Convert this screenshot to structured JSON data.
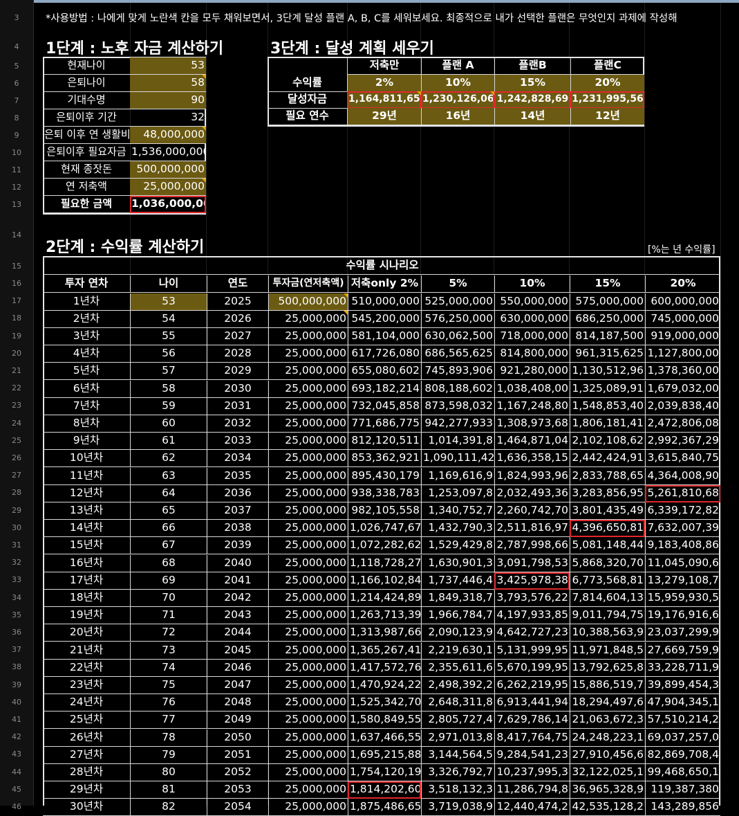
{
  "note": "*사용방법 : 나에게 맞게 노란색 칸을 모두 채워보면서, 3단계 달성 플랜 A, B, C를 세워보세요. 최종적으로 내가 선택한 플랜은 무엇인지 과제에 작성해",
  "row_numbers": [
    "3",
    "4",
    "5",
    "6",
    "7",
    "8",
    "9",
    "10",
    "11",
    "12",
    "13",
    "14",
    "15",
    "16",
    "17",
    "18",
    "19",
    "20",
    "21",
    "22",
    "23",
    "24",
    "25",
    "26",
    "27",
    "28",
    "29",
    "30",
    "31",
    "32",
    "33",
    "34",
    "35",
    "36",
    "37",
    "38",
    "39",
    "40",
    "41",
    "42",
    "43",
    "44",
    "45",
    "46"
  ],
  "step1": {
    "title": "1단계 : 노후 자금 계산하기",
    "rows": [
      {
        "label": "현재나이",
        "value": "53"
      },
      {
        "label": "은퇴나이",
        "value": "58"
      },
      {
        "label": "기대수명",
        "value": "90"
      },
      {
        "label": "은퇴이후 기간",
        "value": "32"
      },
      {
        "label": "은퇴 이후 연 생활비",
        "value": "48,000,000"
      },
      {
        "label": "은퇴이후 필요자금",
        "value": "1,536,000,000"
      },
      {
        "label": "현재 종잣돈",
        "value": "500,000,000"
      },
      {
        "label": "연 저축액",
        "value": "25,000,000"
      },
      {
        "label": "필요한 금액",
        "value": "1,036,000,000"
      }
    ]
  },
  "step3": {
    "title": "3단계 : 달성 계획 세우기",
    "headers": [
      "저축만",
      "플랜 A",
      "플랜B",
      "플랜C"
    ],
    "row_labels": [
      "수익률",
      "달성자금",
      "필요 연수"
    ],
    "returns": [
      "2%",
      "10%",
      "15%",
      "20%"
    ],
    "funds": [
      "1,164,811,650",
      "1,230,126,06",
      "1,242,828,69",
      "1,231,995,56"
    ],
    "years": [
      "29년",
      "16년",
      "14년",
      "12년"
    ]
  },
  "step2": {
    "title": "2단계 : 수익률 계산하기",
    "unit_note": "[%는 년 수익률]",
    "scenario_header": "수익률 시나리오",
    "headers": [
      "투자 연차",
      "나이",
      "연도",
      "투자금(연저축액)",
      "저축only 2%",
      "5%",
      "10%",
      "15%",
      "20%"
    ],
    "rows": [
      [
        "1년차",
        "53",
        "2025",
        "500,000,000",
        "510,000,000",
        "525,000,000",
        "550,000,000",
        "575,000,000",
        "600,000,000"
      ],
      [
        "2년차",
        "54",
        "2026",
        "25,000,000",
        "545,200,000",
        "576,250,000",
        "630,000,000",
        "686,250,000",
        "745,000,000"
      ],
      [
        "3년차",
        "55",
        "2027",
        "25,000,000",
        "581,104,000",
        "630,062,500",
        "718,000,000",
        "814,187,500",
        "919,000,000"
      ],
      [
        "4년차",
        "56",
        "2028",
        "25,000,000",
        "617,726,080",
        "686,565,625",
        "814,800,000",
        "961,315,625",
        "1,127,800,00"
      ],
      [
        "5년차",
        "57",
        "2029",
        "25,000,000",
        "655,080,602",
        "745,893,906",
        "921,280,000",
        "1,130,512,96",
        "1,378,360,00"
      ],
      [
        "6년차",
        "58",
        "2030",
        "25,000,000",
        "693,182,214",
        "808,188,602",
        "1,038,408,00",
        "1,325,089,91",
        "1,679,032,00"
      ],
      [
        "7년차",
        "59",
        "2031",
        "25,000,000",
        "732,045,858",
        "873,598,032",
        "1,167,248,80",
        "1,548,853,40",
        "2,039,838,40"
      ],
      [
        "8년차",
        "60",
        "2032",
        "25,000,000",
        "771,686,775",
        "942,277,933",
        "1,308,973,68",
        "1,806,181,41",
        "2,472,806,08"
      ],
      [
        "9년차",
        "61",
        "2033",
        "25,000,000",
        "812,120,511",
        "1,014,391,8",
        "1,464,871,04",
        "2,102,108,62",
        "2,992,367,29"
      ],
      [
        "10년차",
        "62",
        "2034",
        "25,000,000",
        "853,362,921",
        "1,090,111,42",
        "1,636,358,15",
        "2,442,424,91",
        "3,615,840,75"
      ],
      [
        "11년차",
        "63",
        "2035",
        "25,000,000",
        "895,430,179",
        "1,169,616,9",
        "1,824,993,96",
        "2,833,788,65",
        "4,364,008,90"
      ],
      [
        "12년차",
        "64",
        "2036",
        "25,000,000",
        "938,338,783",
        "1,253,097,8",
        "2,032,493,36",
        "3,283,856,95",
        "5,261,810,68"
      ],
      [
        "13년차",
        "65",
        "2037",
        "25,000,000",
        "982,105,558",
        "1,340,752,7",
        "2,260,742,70",
        "3,801,435,49",
        "6,339,172,82"
      ],
      [
        "14년차",
        "66",
        "2038",
        "25,000,000",
        "1,026,747,67",
        "1,432,790,3",
        "2,511,816,97",
        "4,396,650,81",
        "7,632,007,39"
      ],
      [
        "15년차",
        "67",
        "2039",
        "25,000,000",
        "1,072,282,62",
        "1,529,429,8",
        "2,787,998,66",
        "5,081,148,44",
        "9,183,408,86"
      ],
      [
        "16년차",
        "68",
        "2040",
        "25,000,000",
        "1,118,728,27",
        "1,630,901,3",
        "3,091,798,53",
        "5,868,320,70",
        "11,045,090,6"
      ],
      [
        "17년차",
        "69",
        "2041",
        "25,000,000",
        "1,166,102,84",
        "1,737,446,4",
        "3,425,978,38",
        "6,773,568,81",
        "13,279,108,7"
      ],
      [
        "18년차",
        "70",
        "2042",
        "25,000,000",
        "1,214,424,89",
        "1,849,318,7",
        "3,793,576,22",
        "7,814,604,13",
        "15,959,930,5"
      ],
      [
        "19년차",
        "71",
        "2043",
        "25,000,000",
        "1,263,713,39",
        "1,966,784,7",
        "4,197,933,85",
        "9,011,794,75",
        "19,176,916,6"
      ],
      [
        "20년차",
        "72",
        "2044",
        "25,000,000",
        "1,313,987,66",
        "2,090,123,9",
        "4,642,727,23",
        "10,388,563,9",
        "23,037,299,9"
      ],
      [
        "21년차",
        "73",
        "2045",
        "25,000,000",
        "1,365,267,41",
        "2,219,630,1",
        "5,131,999,95",
        "11,971,848,5",
        "27,669,759,9"
      ],
      [
        "22년차",
        "74",
        "2046",
        "25,000,000",
        "1,417,572,76",
        "2,355,611,6",
        "5,670,199,95",
        "13,792,625,8",
        "33,228,711,9"
      ],
      [
        "23년차",
        "75",
        "2047",
        "25,000,000",
        "1,470,924,22",
        "2,498,392,2",
        "6,262,219,95",
        "15,886,519,7",
        "39,899,454,3"
      ],
      [
        "24년차",
        "76",
        "2048",
        "25,000,000",
        "1,525,342,70",
        "2,648,311,8",
        "6,913,441,94",
        "18,294,497,6",
        "47,904,345,1"
      ],
      [
        "25년차",
        "77",
        "2049",
        "25,000,000",
        "1,580,849,55",
        "2,805,727,4",
        "7,629,786,14",
        "21,063,672,3",
        "57,510,214,2"
      ],
      [
        "26년차",
        "78",
        "2050",
        "25,000,000",
        "1,637,466,55",
        "2,971,013,8",
        "8,417,764,75",
        "24,248,223,1",
        "69,037,257,0"
      ],
      [
        "27년차",
        "79",
        "2051",
        "25,000,000",
        "1,695,215,88",
        "3,144,564,5",
        "9,284,541,23",
        "27,910,456,6",
        "82,869,708,4"
      ],
      [
        "28년차",
        "80",
        "2052",
        "25,000,000",
        "1,754,120,19",
        "3,326,792,7",
        "10,237,995,3",
        "32,122,025,1",
        "99,468,650,1"
      ],
      [
        "29년차",
        "81",
        "2053",
        "25,000,000",
        "1,814,202,60",
        "3,518,132,3",
        "11,286,794,8",
        "36,965,328,9",
        "119,387,380"
      ],
      [
        "30년차",
        "82",
        "2054",
        "25,000,000",
        "1,875,486,65",
        "3,719,038,9",
        "12,440,474,2",
        "42,535,128,2",
        "143,289,856"
      ]
    ]
  },
  "colors": {
    "yellow_cell": "#6b5a12",
    "highlight": "#e0282c",
    "note_triangle": "#e8a400"
  }
}
